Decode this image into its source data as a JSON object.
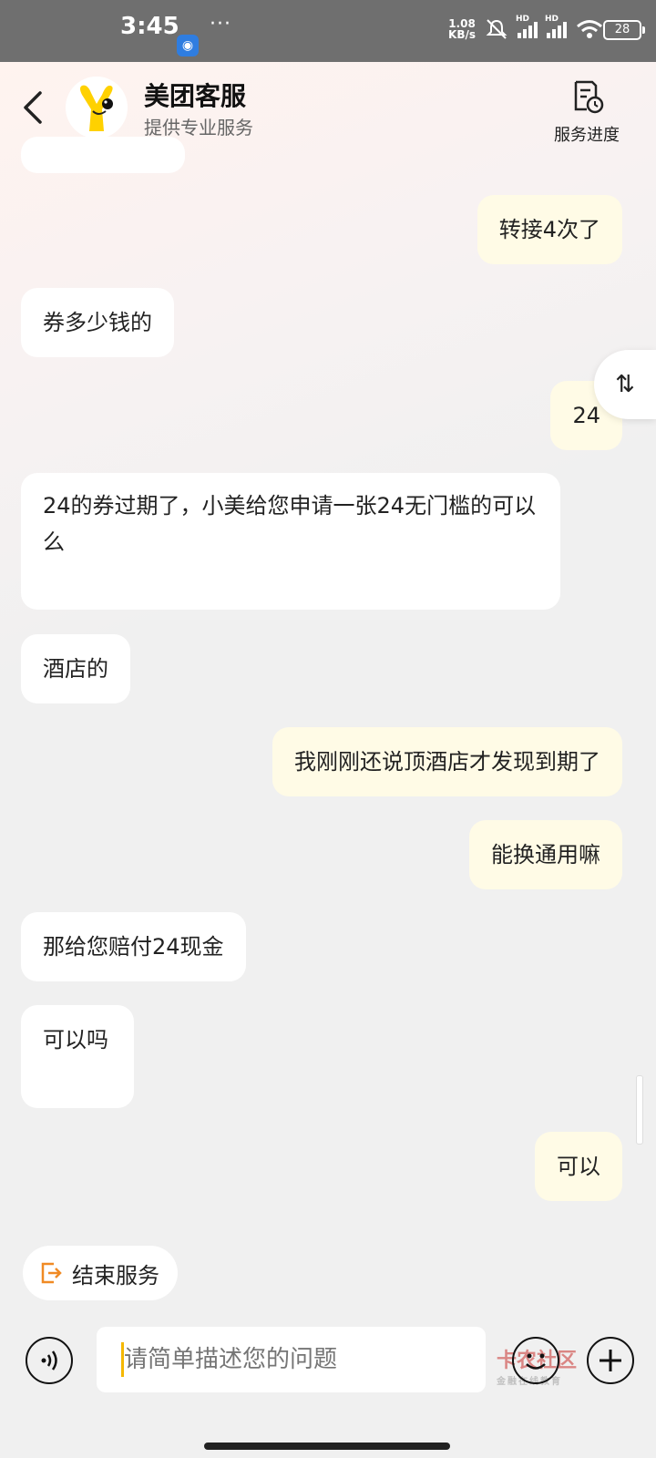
{
  "status_bar": {
    "time": "3:45",
    "more": "···",
    "speed_value": "1.08",
    "speed_unit": "KB/s",
    "hd1": "HD",
    "hd2": "HD",
    "battery": "28"
  },
  "header": {
    "title": "美团客服",
    "subtitle": "提供专业服务",
    "progress_label": "服务进度"
  },
  "messages": [
    {
      "side": "right",
      "text": "转接4次了"
    },
    {
      "side": "left",
      "text": "券多少钱的"
    },
    {
      "side": "right",
      "text": "24"
    },
    {
      "side": "left",
      "text": "24的券过期了，小美给您申请一张24无门槛的可以么"
    },
    {
      "side": "left",
      "text": "酒店的"
    },
    {
      "side": "right",
      "text": "我刚刚还说顶酒店才发现到期了"
    },
    {
      "side": "right",
      "text": "能换通用嘛"
    },
    {
      "side": "left",
      "text": "那给您赔付24现金"
    },
    {
      "side": "left",
      "text": "可以吗"
    },
    {
      "side": "right",
      "text": "可以"
    }
  ],
  "float_button": "⇅",
  "bottom_bar": {
    "end_service_label": "结束服务",
    "input_placeholder": "请简单描述您的问题"
  },
  "watermark": {
    "text": "卡农社区",
    "sub": "金融在线教育"
  },
  "colors": {
    "user_bubble": "#fffbe6",
    "agent_bubble": "#ffffff",
    "accent": "#f5b800",
    "end_icon": "#f08a24"
  }
}
